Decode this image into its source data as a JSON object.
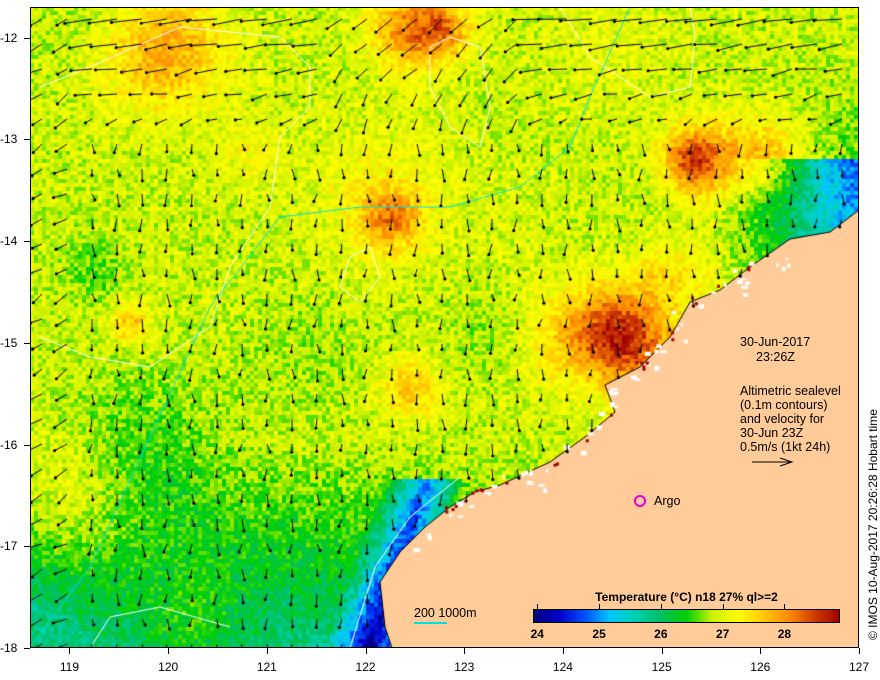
{
  "map": {
    "lon_ticks": [
      "119",
      "120",
      "121",
      "122",
      "123",
      "124",
      "125",
      "126",
      "127"
    ],
    "lat_ticks": [
      "-12",
      "-13",
      "-14",
      "-15",
      "-16",
      "-17",
      "-18"
    ],
    "lon_range": [
      118.6,
      127.0
    ],
    "lat_range": [
      -11.7,
      -18.0
    ],
    "land_color": "#FFCC99"
  },
  "annotations": {
    "date": "30-Jun-2017",
    "time": "23:26Z",
    "legend_lines": [
      "Altimetric sealevel",
      "(0.1m contours)",
      "and velocity for",
      "30-Jun 23Z",
      "0.5m/s (1kt 24h)"
    ],
    "argo_label": "Argo",
    "bathy_label": "200  1000m",
    "credit": "© IMOS 10-Aug-2017 20:26:28 Hobart time"
  },
  "colorbar": {
    "title": "Temperature (°C) n18 27% ql>=2",
    "ticks": [
      "24",
      "25",
      "26",
      "27",
      "28"
    ],
    "range": [
      23.93,
      28.9
    ],
    "colors": [
      "#00007f",
      "#0000c8",
      "#0050ff",
      "#00c8ff",
      "#00d0b0",
      "#00c060",
      "#00d000",
      "#c8f000",
      "#ffff00",
      "#ffc800",
      "#ff8c00",
      "#d04000",
      "#a00000"
    ]
  }
}
